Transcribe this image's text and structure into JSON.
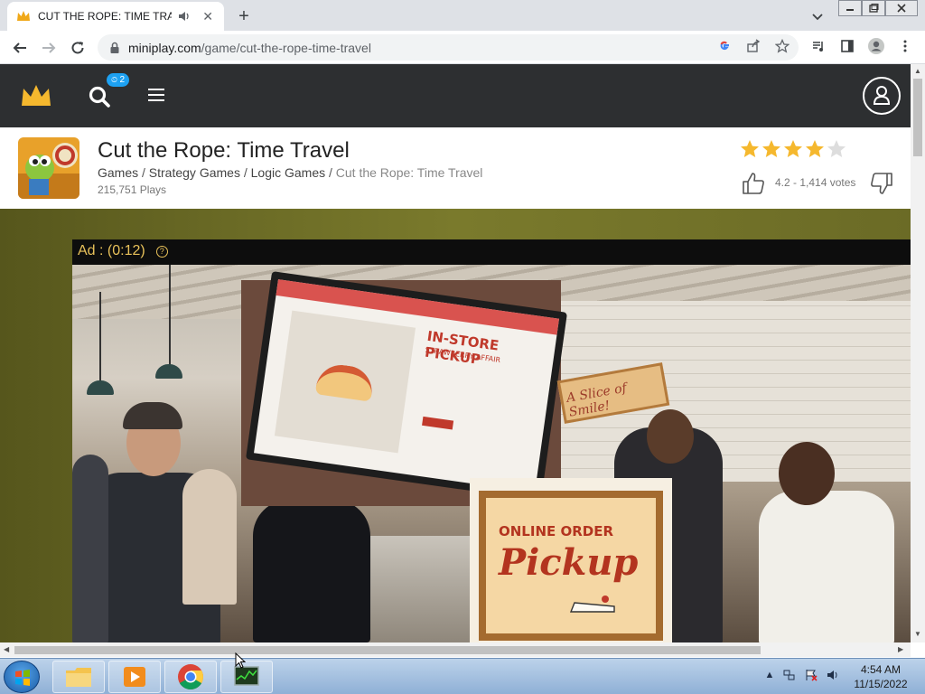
{
  "browser": {
    "tab_title": "CUT THE ROPE: TIME TRAVEL",
    "tab_close": "✕",
    "new_tab": "+",
    "url_domain": "miniplay.com",
    "url_path": "/game/cut-the-rope-time-travel"
  },
  "site": {
    "notification_count": "2"
  },
  "game": {
    "title": "Cut the Rope: Time Travel",
    "breadcrumb": [
      "Games",
      "Strategy Games",
      "Logic Games",
      "Cut the Rope: Time Travel"
    ],
    "separator": " / ",
    "plays": "215,751 Plays",
    "rating_stars_filled": 4,
    "rating_stars_total": 5,
    "rating_text": "4.2 - 1,414 votes"
  },
  "ad": {
    "label": "Ad : (0:12)",
    "help": "?",
    "screen_heading": "IN-STORE PICKUP",
    "screen_sub": "STRAWBERRY AFFAIR",
    "sign_text": "A Slice of Smile!",
    "card_line1": "ONLINE ORDER",
    "card_line2": "Pickup"
  },
  "taskbar": {
    "time": "4:54 AM",
    "date": "11/15/2022",
    "apps": [
      "file-explorer",
      "media-player",
      "chrome",
      "task-manager"
    ]
  },
  "colors": {
    "site_header": "#2d2f31",
    "star": "#f5b82e",
    "badge": "#1da1f2",
    "ad_label": "#e8c15a"
  }
}
